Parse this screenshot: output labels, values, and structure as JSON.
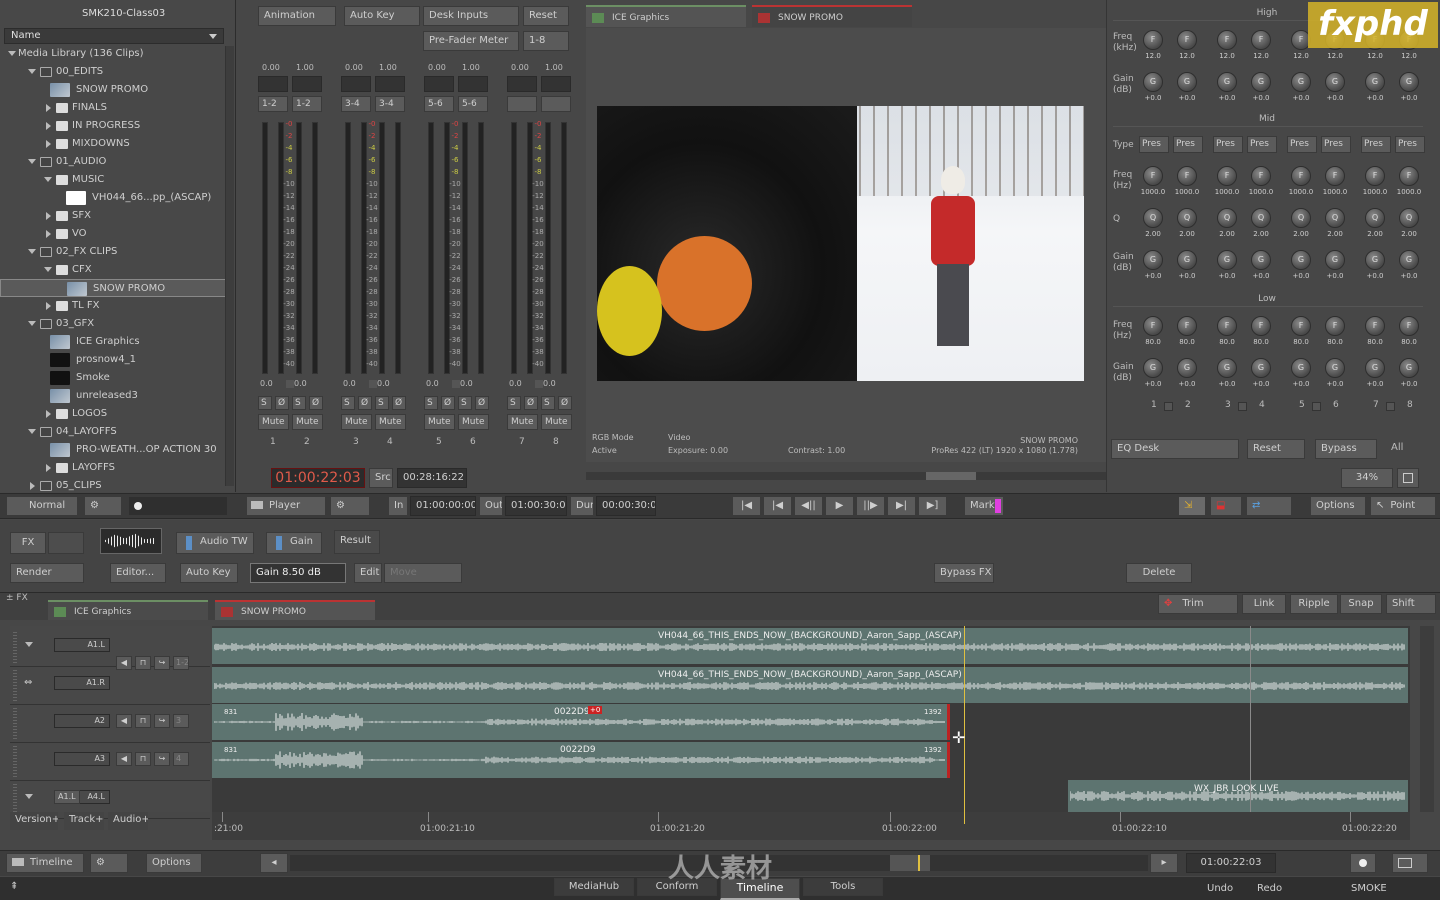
{
  "brand": {
    "watermark": "fxphd",
    "bottom_logo": "人人素材"
  },
  "library": {
    "project": "SMK210-Class03",
    "name_col": "Name",
    "root": "Media Library (136 Clips)",
    "items": [
      {
        "label": "00_EDITS",
        "depth": 1,
        "type": "lib",
        "open": true
      },
      {
        "label": "SNOW PROMO",
        "depth": 2,
        "type": "clip"
      },
      {
        "label": "FINALS",
        "depth": 2,
        "type": "folder"
      },
      {
        "label": "IN PROGRESS",
        "depth": 2,
        "type": "folder"
      },
      {
        "label": "MIXDOWNS",
        "depth": 2,
        "type": "folder"
      },
      {
        "label": "01_AUDIO",
        "depth": 1,
        "type": "lib",
        "open": true
      },
      {
        "label": "MUSIC",
        "depth": 2,
        "type": "folder",
        "open": true
      },
      {
        "label": "VH044_66...pp_(ASCAP)",
        "depth": 3,
        "type": "audio"
      },
      {
        "label": "SFX",
        "depth": 2,
        "type": "folder"
      },
      {
        "label": "VO",
        "depth": 2,
        "type": "folder"
      },
      {
        "label": "02_FX CLIPS",
        "depth": 1,
        "type": "lib",
        "open": true
      },
      {
        "label": "CFX",
        "depth": 2,
        "type": "folder",
        "open": true
      },
      {
        "label": "SNOW PROMO",
        "depth": 3,
        "type": "clip",
        "selected": true
      },
      {
        "label": "TL FX",
        "depth": 2,
        "type": "folder"
      },
      {
        "label": "03_GFX",
        "depth": 1,
        "type": "lib",
        "open": true
      },
      {
        "label": "ICE Graphics",
        "depth": 2,
        "type": "clip"
      },
      {
        "label": "prosnow4_1",
        "depth": 2,
        "type": "black"
      },
      {
        "label": "Smoke",
        "depth": 2,
        "type": "black"
      },
      {
        "label": "unreleased3",
        "depth": 2,
        "type": "clip"
      },
      {
        "label": "LOGOS",
        "depth": 2,
        "type": "folder"
      },
      {
        "label": "04_LAYOFFS",
        "depth": 1,
        "type": "lib",
        "open": true
      },
      {
        "label": "PRO-WEATH...OP ACTION 30",
        "depth": 2,
        "type": "clip"
      },
      {
        "label": "LAYOFFS",
        "depth": 2,
        "type": "folder"
      },
      {
        "label": "05_CLIPS",
        "depth": 1,
        "type": "lib"
      }
    ]
  },
  "mixer": {
    "top_buttons": [
      "Animation",
      "Auto Key",
      "Desk Inputs",
      "Reset",
      "Pre-Fader Meter",
      "1-8"
    ],
    "pairs": [
      {
        "range": [
          "0.00",
          "1.00"
        ],
        "route": [
          "1-2",
          "1-2"
        ],
        "bottom": [
          "0.0",
          "0.0"
        ],
        "mute": [
          "Mute",
          "Mute"
        ],
        "num": [
          "1",
          "2"
        ]
      },
      {
        "range": [
          "0.00",
          "1.00"
        ],
        "route": [
          "3-4",
          "3-4"
        ],
        "bottom": [
          "0.0",
          "0.0"
        ],
        "mute": [
          "Mute",
          "Mute"
        ],
        "num": [
          "3",
          "4"
        ]
      },
      {
        "range": [
          "0.00",
          "1.00"
        ],
        "route": [
          "5-6",
          "5-6"
        ],
        "bottom": [
          "0.0",
          "0.0"
        ],
        "mute": [
          "Mute",
          "Mute"
        ],
        "num": [
          "5",
          "6"
        ]
      },
      {
        "range": [
          "0.00",
          "1.00"
        ],
        "route": [
          "",
          ""
        ],
        "bottom": [
          "0.0",
          "0.0"
        ],
        "mute": [
          "Mute",
          "Mute"
        ],
        "num": [
          "7",
          "8"
        ]
      }
    ],
    "scale": [
      "-0",
      "-2",
      "-4",
      "-6",
      "-8",
      "-10",
      "-12",
      "-14",
      "-16",
      "-18",
      "-20",
      "-22",
      "-24",
      "-26",
      "-28",
      "-30",
      "-32",
      "-34",
      "-36",
      "-38",
      "-40"
    ],
    "sm": [
      "S",
      "Ø",
      "S",
      "Ø"
    ]
  },
  "viewer": {
    "tabs": [
      "ICE Graphics",
      "SNOW PROMO"
    ],
    "info_left": [
      "RGB Mode",
      "Active"
    ],
    "info_mid": [
      "Video",
      "Exposure: 0.00"
    ],
    "info_contrast": "Contrast: 1.00",
    "info_right": [
      "SNOW PROMO",
      "ProRes 422 (LT) 1920 x 1080 (1.778)"
    ],
    "timecode": "01:00:22:03",
    "src_label": "Src",
    "src_tc": "00:28:16:22",
    "zoom": "34%"
  },
  "eq": {
    "high": "High",
    "mid": "Mid",
    "low": "Low",
    "freq_label": "Freq\n(kHz)",
    "freq_hz": "Freq\n(Hz)",
    "gain_label": "Gain\n(dB)",
    "type_label": "Type",
    "q_label": "Q",
    "high_freq": "12.0",
    "gain_val": "+0.0",
    "mid_freq": "1000.0",
    "q_val": "2.00",
    "low_freq": "80.0",
    "preset": "Pres",
    "channels": [
      "1",
      "2",
      "3",
      "4",
      "5",
      "6",
      "7",
      "8"
    ],
    "desk": "EQ Desk",
    "reset": "Reset",
    "bypass": "Bypass",
    "all": "All"
  },
  "transport": {
    "mode": "Normal",
    "player": "Player",
    "in_label": "In",
    "in_tc": "01:00:00:00",
    "out_label": "Out",
    "out_tc": "01:00:30:00",
    "dur_label": "Dur",
    "dur_tc": "00:00:30:01",
    "mark": "Mark",
    "options": "Options",
    "point": "Point"
  },
  "fx": {
    "fx": "FX",
    "audio_tw": "Audio TW",
    "gain_node": "Gain",
    "result": "Result",
    "render": "Render",
    "editor": "Editor...",
    "auto_key": "Auto Key",
    "gain_value": "Gain 8.50 dB",
    "edit": "Edit",
    "move": "Move",
    "bypass_fx": "Bypass FX",
    "delete": "Delete"
  },
  "timeline": {
    "fx_label": "FX",
    "tabs": [
      "ICE Graphics",
      "SNOW PROMO"
    ],
    "tools": [
      "Trim",
      "Link",
      "Ripple",
      "Snap",
      "Shift"
    ],
    "tracks": [
      {
        "name": "A1.L",
        "extra": "1-2"
      },
      {
        "name": "A1.R",
        "extra": ""
      },
      {
        "name": "A2",
        "extra": "3"
      },
      {
        "name": "A3",
        "extra": "4"
      },
      {
        "name": "A4.L",
        "src": "A1.L",
        "extra": ""
      }
    ],
    "clips": {
      "music_title": "VH044_66_THIS_ENDS_NOW_(BACKGROUND)_Aaron_Sapp_(ASCAP)",
      "a2_id": "0022D9",
      "a3_id": "0022D9",
      "frame_start": "831",
      "frame_end": "1392",
      "badge": "+0",
      "lookalive": "WX_JBR LOOK LIVE"
    },
    "buttons": [
      "Version+",
      "Track+",
      "Audio+"
    ],
    "ruler": [
      ":21:00",
      "01:00:21:10",
      "01:00:21:20",
      "01:00:22:00",
      "01:00:22:10",
      "01:00:22:20"
    ],
    "bottom": {
      "view": "Timeline",
      "options": "Options",
      "tc": "01:00:22:03"
    }
  },
  "footer": {
    "tabs": [
      "MediaHub",
      "Conform",
      "Timeline",
      "Tools"
    ],
    "undo": "Undo",
    "redo": "Redo",
    "workspace": "SMOKE"
  }
}
